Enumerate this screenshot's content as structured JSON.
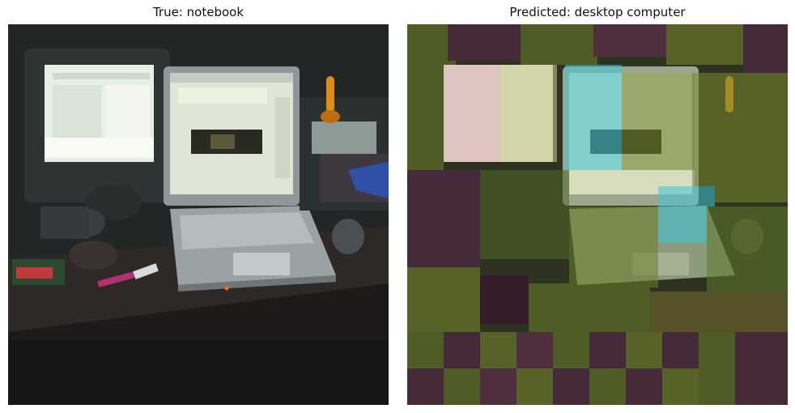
{
  "panels": [
    {
      "id": "left",
      "title": "True: notebook"
    },
    {
      "id": "right",
      "title": "Predicted: desktop computer"
    }
  ],
  "colors": {
    "scene_dark": "#1a1c1c",
    "desk": "#2a2524",
    "monitor_glow": "#e9f2e6",
    "laptop_body": "#a7aeb0",
    "lamp": "#e08b16",
    "overlay_green": "#6b7f2a",
    "overlay_purple": "#5a2350",
    "overlay_cyan": "#3ec6d8",
    "overlay_pink": "#d8a8b8"
  }
}
